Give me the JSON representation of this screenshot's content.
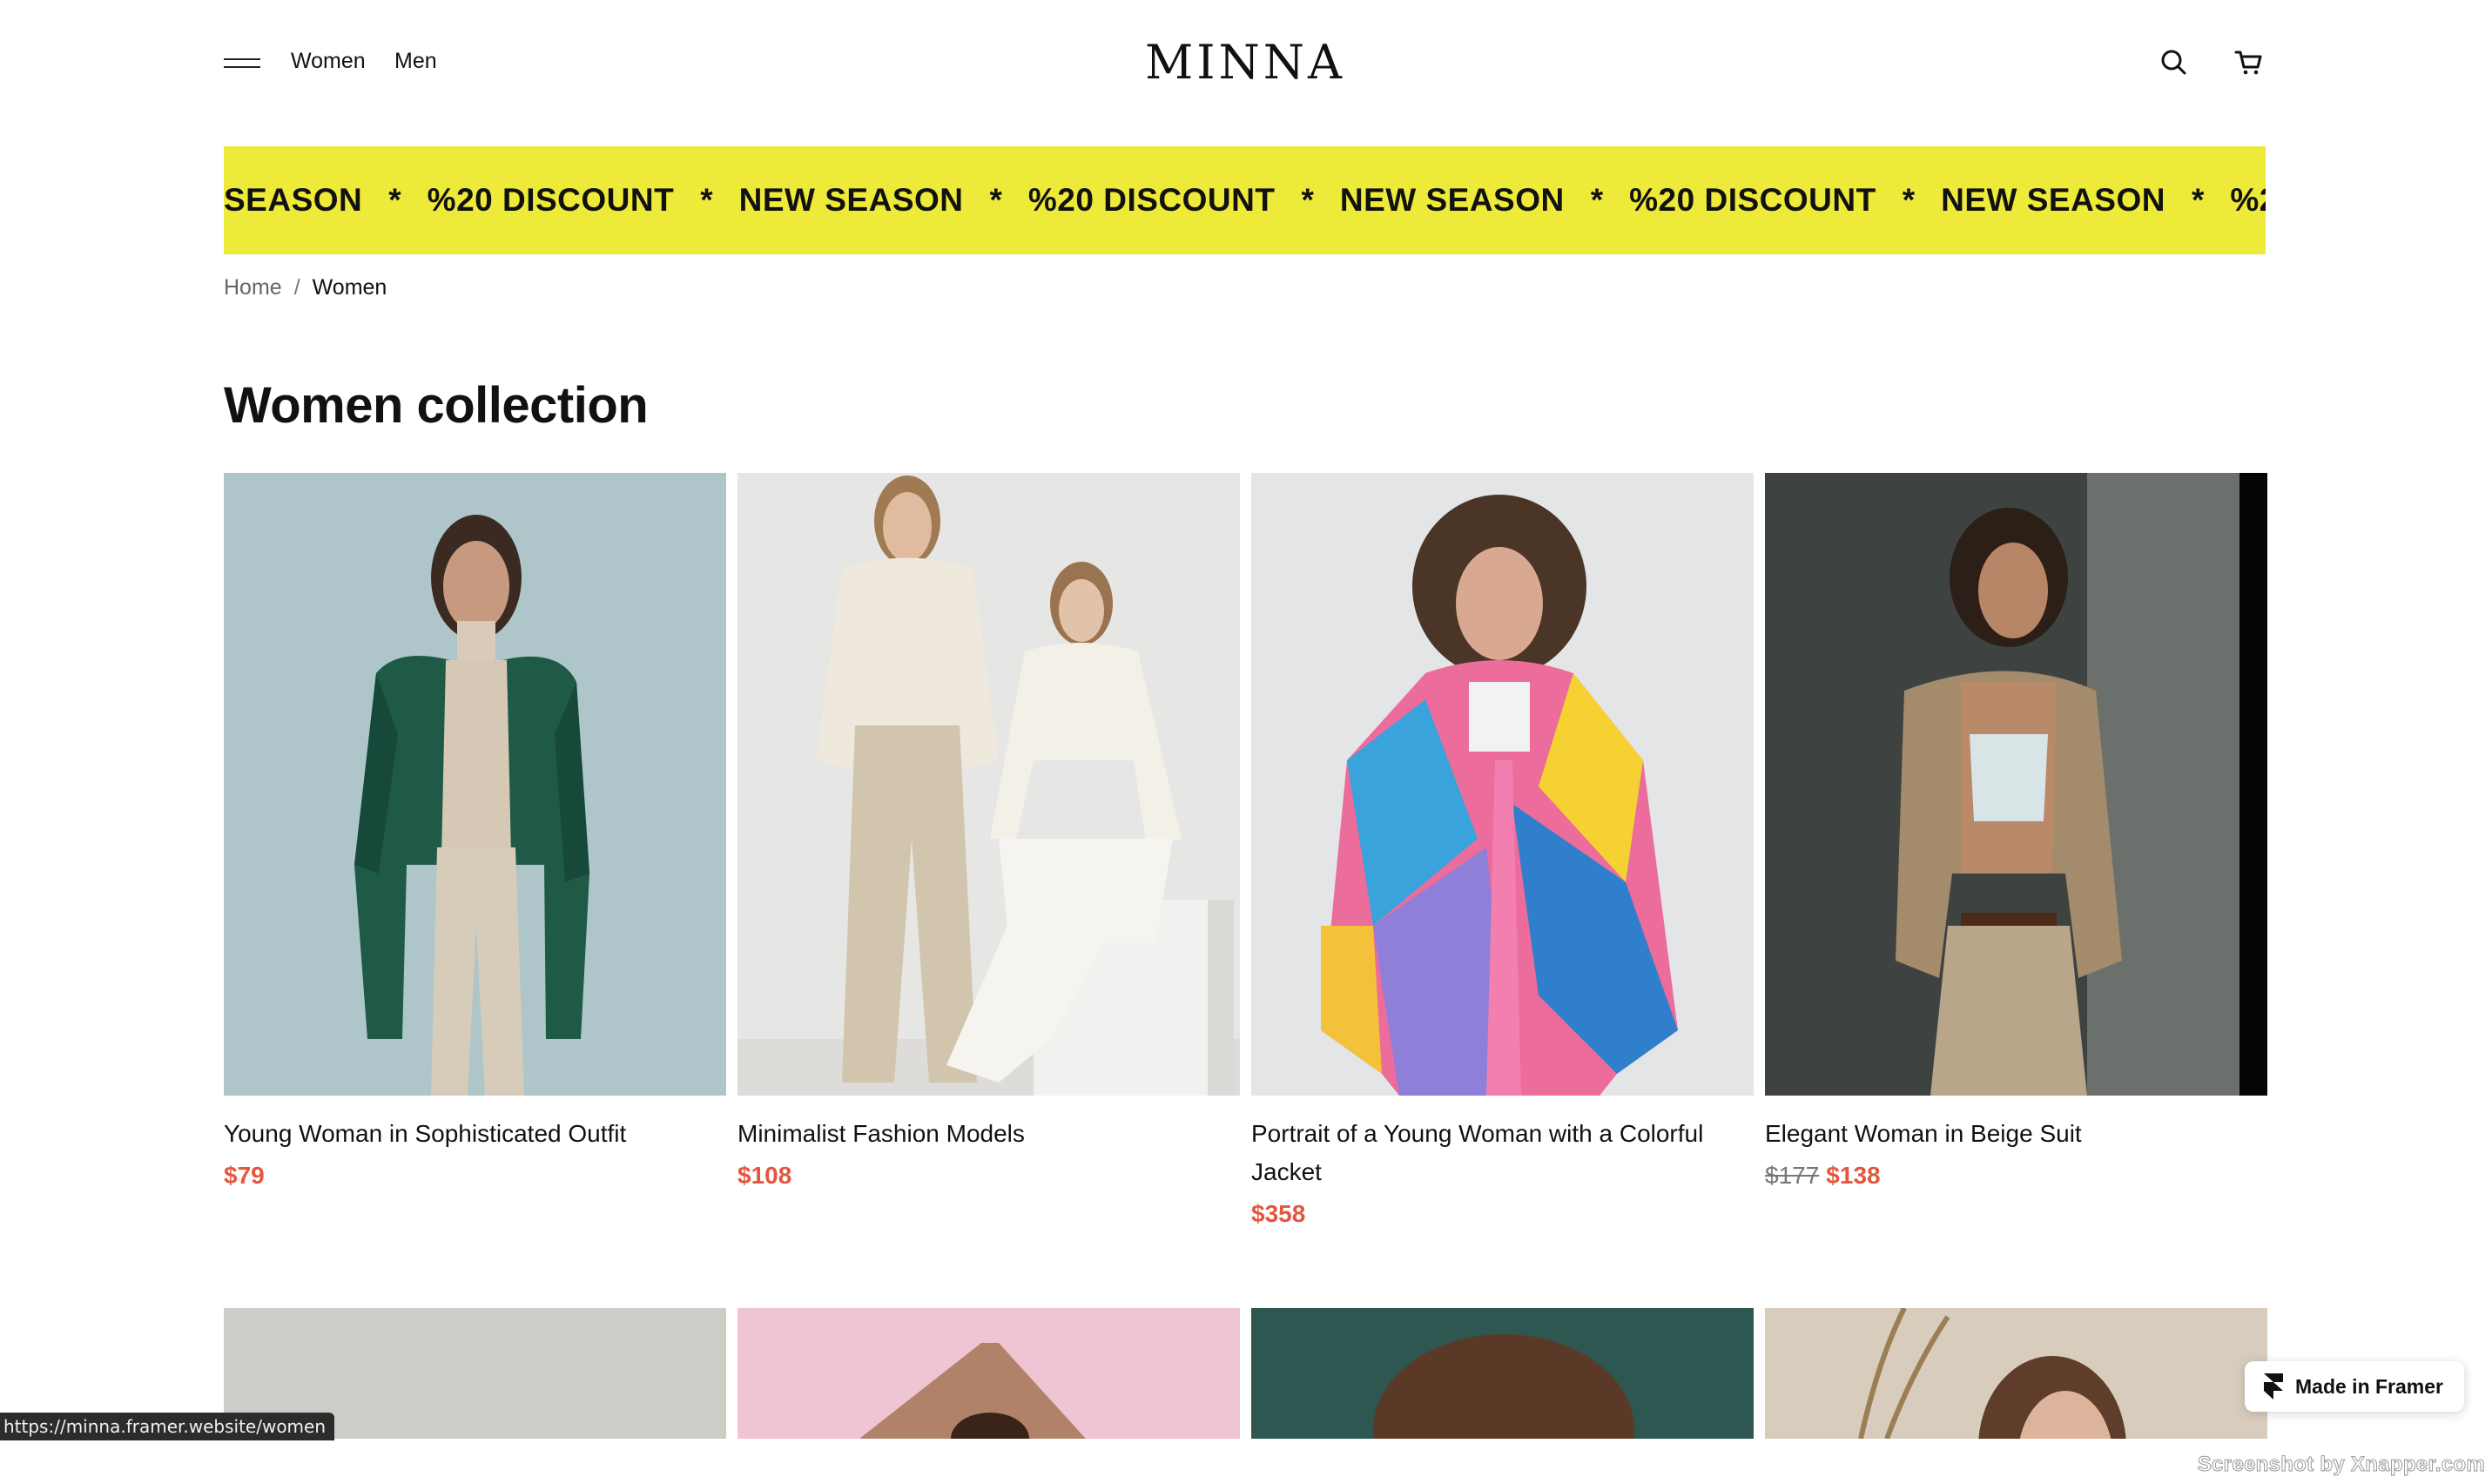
{
  "header": {
    "logo": "MINNA",
    "nav": [
      {
        "label": "Women"
      },
      {
        "label": "Men"
      }
    ]
  },
  "marquee": {
    "items": [
      "SEASON",
      "%20 DISCOUNT",
      "NEW SEASON",
      "%20 DISCOUNT",
      "NEW SEASON",
      "%20 DISCOUNT",
      "NEW SEASON",
      "%20 DISCO"
    ],
    "separator": "*",
    "background": "#eeea39"
  },
  "breadcrumb": {
    "home": "Home",
    "separator": "/",
    "current": "Women"
  },
  "page": {
    "title": "Women collection"
  },
  "products": [
    {
      "name": "Young Woman in Sophisticated Outfit",
      "price": "$79",
      "old_price": ""
    },
    {
      "name": "Minimalist Fashion Models",
      "price": "$108",
      "old_price": ""
    },
    {
      "name": "Portrait of a Young Woman with a Colorful Jacket",
      "price": "$358",
      "old_price": ""
    },
    {
      "name": "Elegant Woman in Beige Suit",
      "price": "$138",
      "old_price": "$177"
    }
  ],
  "status_url": "https://minna.framer.website/women",
  "framer_badge": "Made in Framer",
  "watermark": "Screenshot by Xnapper.com",
  "colors": {
    "accent_price": "#e4573e",
    "marquee": "#eeea39"
  }
}
